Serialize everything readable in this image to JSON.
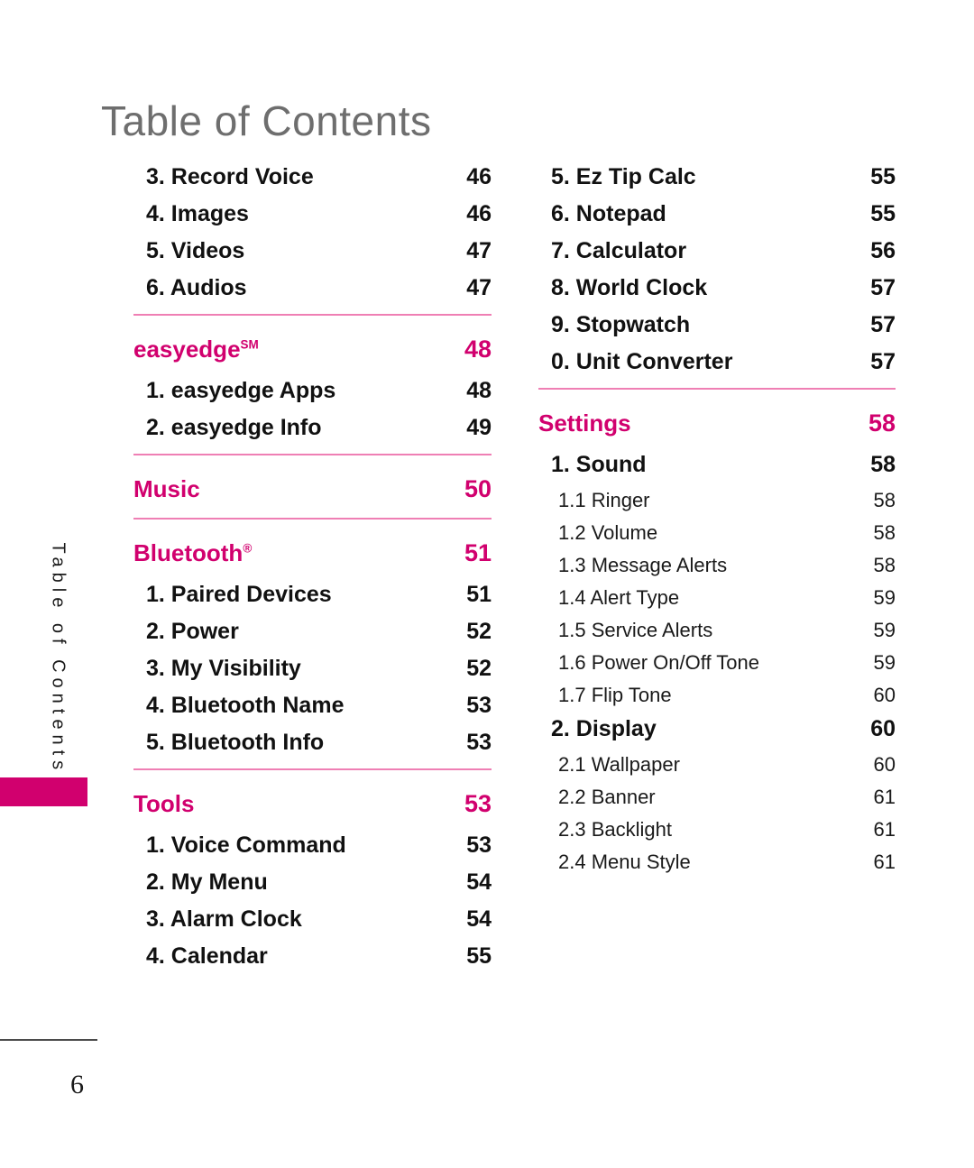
{
  "page": {
    "title": "Table of Contents",
    "side_tab_label": "Table of Contents",
    "page_number": "6",
    "accent_color": "#d1006e",
    "divider_color": "#ef7fb4",
    "title_color": "#6e6e6e"
  },
  "columns": [
    {
      "id": "left",
      "rows": [
        {
          "level": "item",
          "label": "3. Record Voice",
          "page": "46"
        },
        {
          "level": "item",
          "label": "4. Images",
          "page": "46"
        },
        {
          "level": "item",
          "label": "5. Videos",
          "page": "47"
        },
        {
          "level": "item",
          "label": "6. Audios",
          "page": "47"
        },
        {
          "level": "section",
          "label": "easyedge",
          "sup": "SM",
          "page": "48"
        },
        {
          "level": "item",
          "label": "1. easyedge Apps",
          "page": "48"
        },
        {
          "level": "item",
          "label": "2. easyedge Info",
          "page": "49"
        },
        {
          "level": "section",
          "label": "Music",
          "page": "50"
        },
        {
          "level": "section",
          "label": "Bluetooth",
          "sup": "®",
          "page": "51"
        },
        {
          "level": "item",
          "label": "1. Paired Devices",
          "page": "51"
        },
        {
          "level": "item",
          "label": "2. Power",
          "page": "52"
        },
        {
          "level": "item",
          "label": "3. My Visibility",
          "page": "52"
        },
        {
          "level": "item",
          "label": "4. Bluetooth Name",
          "page": "53"
        },
        {
          "level": "item",
          "label": "5. Bluetooth Info",
          "page": "53"
        },
        {
          "level": "section",
          "label": "Tools",
          "page": "53"
        },
        {
          "level": "item",
          "label": "1. Voice Command",
          "page": "53"
        },
        {
          "level": "item",
          "label": "2. My Menu",
          "page": "54"
        },
        {
          "level": "item",
          "label": "3. Alarm Clock",
          "page": "54"
        },
        {
          "level": "item",
          "label": "4. Calendar",
          "page": "55"
        }
      ]
    },
    {
      "id": "right",
      "rows": [
        {
          "level": "item",
          "label": "5. Ez Tip Calc",
          "page": "55"
        },
        {
          "level": "item",
          "label": "6. Notepad",
          "page": "55"
        },
        {
          "level": "item",
          "label": "7. Calculator",
          "page": "56"
        },
        {
          "level": "item",
          "label": "8. World Clock",
          "page": "57"
        },
        {
          "level": "item",
          "label": "9. Stopwatch",
          "page": "57"
        },
        {
          "level": "item",
          "label": "0. Unit Converter",
          "page": "57"
        },
        {
          "level": "section",
          "label": "Settings",
          "page": "58"
        },
        {
          "level": "item",
          "label": "1. Sound",
          "page": "58"
        },
        {
          "level": "subitem",
          "label": "1.1 Ringer",
          "page": "58"
        },
        {
          "level": "subitem",
          "label": "1.2 Volume",
          "page": "58"
        },
        {
          "level": "subitem",
          "label": "1.3 Message Alerts",
          "page": "58"
        },
        {
          "level": "subitem",
          "label": "1.4 Alert Type",
          "page": "59"
        },
        {
          "level": "subitem",
          "label": "1.5 Service Alerts",
          "page": "59"
        },
        {
          "level": "subitem",
          "label": "1.6 Power On/Off Tone",
          "page": "59"
        },
        {
          "level": "subitem",
          "label": "1.7 Flip Tone",
          "page": "60"
        },
        {
          "level": "item",
          "label": "2. Display",
          "page": "60"
        },
        {
          "level": "subitem",
          "label": "2.1 Wallpaper",
          "page": "60"
        },
        {
          "level": "subitem",
          "label": "2.2 Banner",
          "page": "61"
        },
        {
          "level": "subitem",
          "label": "2.3 Backlight",
          "page": "61"
        },
        {
          "level": "subitem",
          "label": "2.4 Menu Style",
          "page": "61"
        }
      ]
    }
  ]
}
